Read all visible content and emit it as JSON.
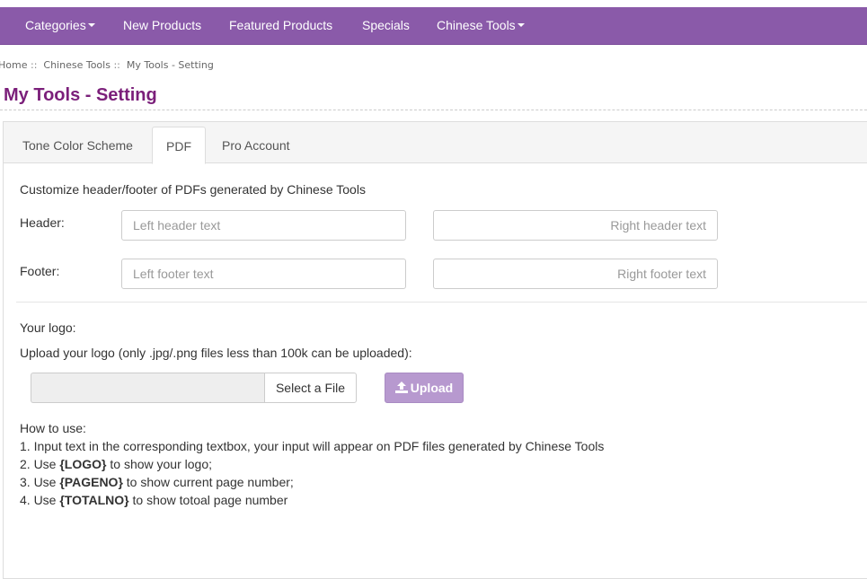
{
  "nav": {
    "categories": "Categories",
    "new_products": "New Products",
    "featured_products": "Featured Products",
    "specials": "Specials",
    "chinese_tools": "Chinese Tools"
  },
  "breadcrumb": {
    "home": "Home",
    "separator": "::",
    "chinese_tools": "Chinese Tools",
    "current": "My Tools - Setting"
  },
  "page_title": "My Tools - Setting",
  "tabs": [
    {
      "label": "Tone Color Scheme",
      "active": false
    },
    {
      "label": "PDF",
      "active": true
    },
    {
      "label": "Pro Account",
      "active": false
    }
  ],
  "pdf": {
    "intro": "Customize header/footer of PDFs generated by Chinese Tools",
    "header_label": "Header:",
    "footer_label": "Footer:",
    "left_header_placeholder": "Left header text",
    "right_header_placeholder": "Right header text",
    "left_footer_placeholder": "Left footer text",
    "right_footer_placeholder": "Right footer text",
    "logo_label": "Your logo:",
    "upload_hint": "Upload your logo (only .jpg/.png files less than 100k can be uploaded):",
    "select_file_label": "Select a File",
    "upload_label": "Upload",
    "upload_icon": "upload-icon"
  },
  "howto": {
    "title": "How to use:",
    "line1": "1. Input text in the corresponding textbox, your input will appear on PDF files generated by Chinese Tools",
    "line2_prefix": "2. Use ",
    "line2_code": "{LOGO}",
    "line2_suffix": " to show your logo;",
    "line3_prefix": "3. Use ",
    "line3_code": "{PAGENO}",
    "line3_suffix": " to show current page number;",
    "line4_prefix": "4. Use ",
    "line4_code": "{TOTALNO}",
    "line4_suffix": " to show totoal page number"
  },
  "colors": {
    "navbar": "#8a5aa9",
    "title": "#7b1f7a",
    "upload_button": "#b799cf"
  }
}
